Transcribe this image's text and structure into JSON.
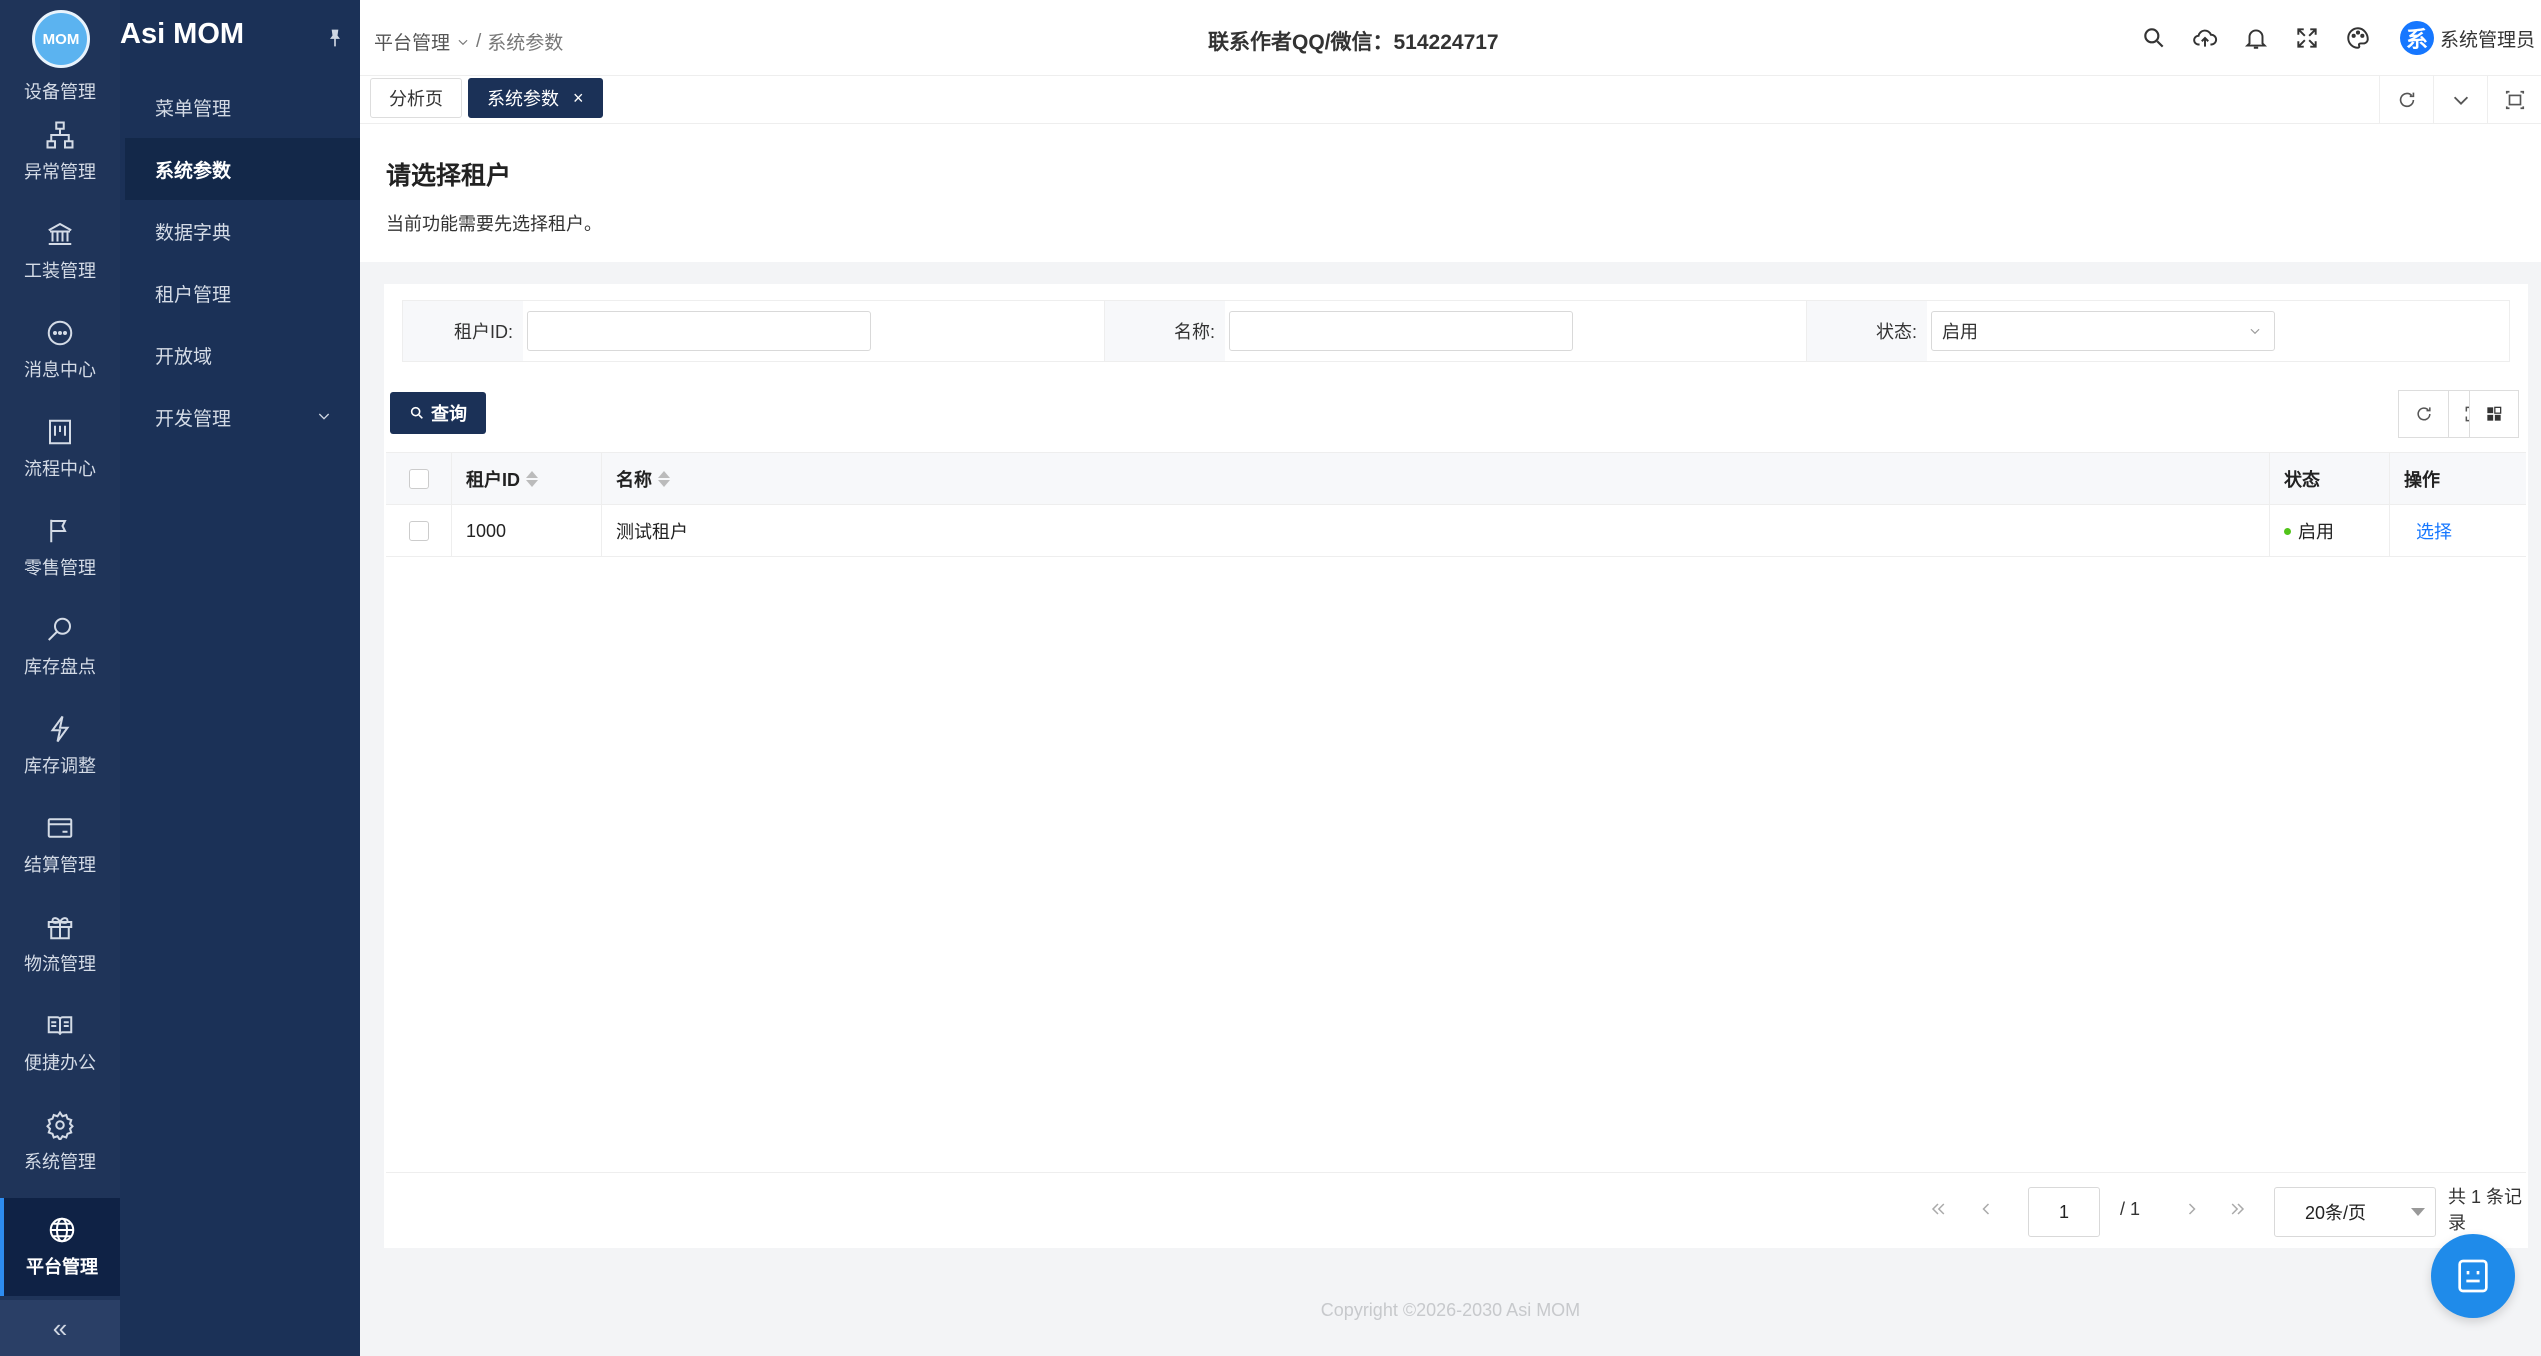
{
  "app": {
    "title": "Asi MOM",
    "logo_text": "MOM"
  },
  "rail": {
    "items": [
      {
        "label": "设备管理",
        "icon": "device-icon"
      },
      {
        "label": "异常管理",
        "icon": "sitemap-icon"
      },
      {
        "label": "工装管理",
        "icon": "bank-icon"
      },
      {
        "label": "消息中心",
        "icon": "message-icon"
      },
      {
        "label": "流程中心",
        "icon": "flow-icon"
      },
      {
        "label": "零售管理",
        "icon": "flag-icon"
      },
      {
        "label": "库存盘点",
        "icon": "file-search-icon"
      },
      {
        "label": "库存调整",
        "icon": "thunder-icon"
      },
      {
        "label": "结算管理",
        "icon": "credit-card-icon"
      },
      {
        "label": "物流管理",
        "icon": "gift-icon"
      },
      {
        "label": "便捷办公",
        "icon": "read-icon"
      },
      {
        "label": "系统管理",
        "icon": "setting-icon"
      },
      {
        "label": "平台管理",
        "icon": "global-icon"
      }
    ],
    "collapse_label": "«"
  },
  "submenu": {
    "items": [
      {
        "label": "菜单管理"
      },
      {
        "label": "系统参数"
      },
      {
        "label": "数据字典"
      },
      {
        "label": "租户管理"
      },
      {
        "label": "开放域"
      },
      {
        "label": "开发管理"
      }
    ]
  },
  "header": {
    "breadcrumb_parent": "平台管理",
    "breadcrumb_sep": "/",
    "breadcrumb_current": "系统参数",
    "contact": "联系作者QQ/微信：514224717",
    "avatar_text": "系",
    "user_name": "系统管理员"
  },
  "tabs": [
    {
      "label": "分析页"
    },
    {
      "label": "系统参数",
      "close": "×"
    }
  ],
  "notice": {
    "title": "请选择租户",
    "description": "当前功能需要先选择租户。"
  },
  "filter": {
    "tenant_id_label": "租户ID:",
    "tenant_id_value": "",
    "name_label": "名称:",
    "name_value": "",
    "status_label": "状态:",
    "status_value": "启用"
  },
  "query_button": "查询",
  "table": {
    "columns": [
      "租户ID",
      "名称",
      "状态",
      "操作"
    ],
    "rows": [
      {
        "tenant_id": "1000",
        "name": "测试租户",
        "status": "启用",
        "action": "选择"
      }
    ]
  },
  "pagination": {
    "current_page": "1",
    "total_pages": "/ 1",
    "page_size": "20条/页",
    "total": "共 1 条记录"
  },
  "footer": {
    "copyright": "Copyright ©2026-2030 Asi MOM"
  },
  "colors": {
    "sidebar": "#1f3459",
    "submenu": "#1b3157",
    "accent": "#1677ff",
    "status_ok": "#52c41a",
    "fab": "#1f8bea"
  }
}
